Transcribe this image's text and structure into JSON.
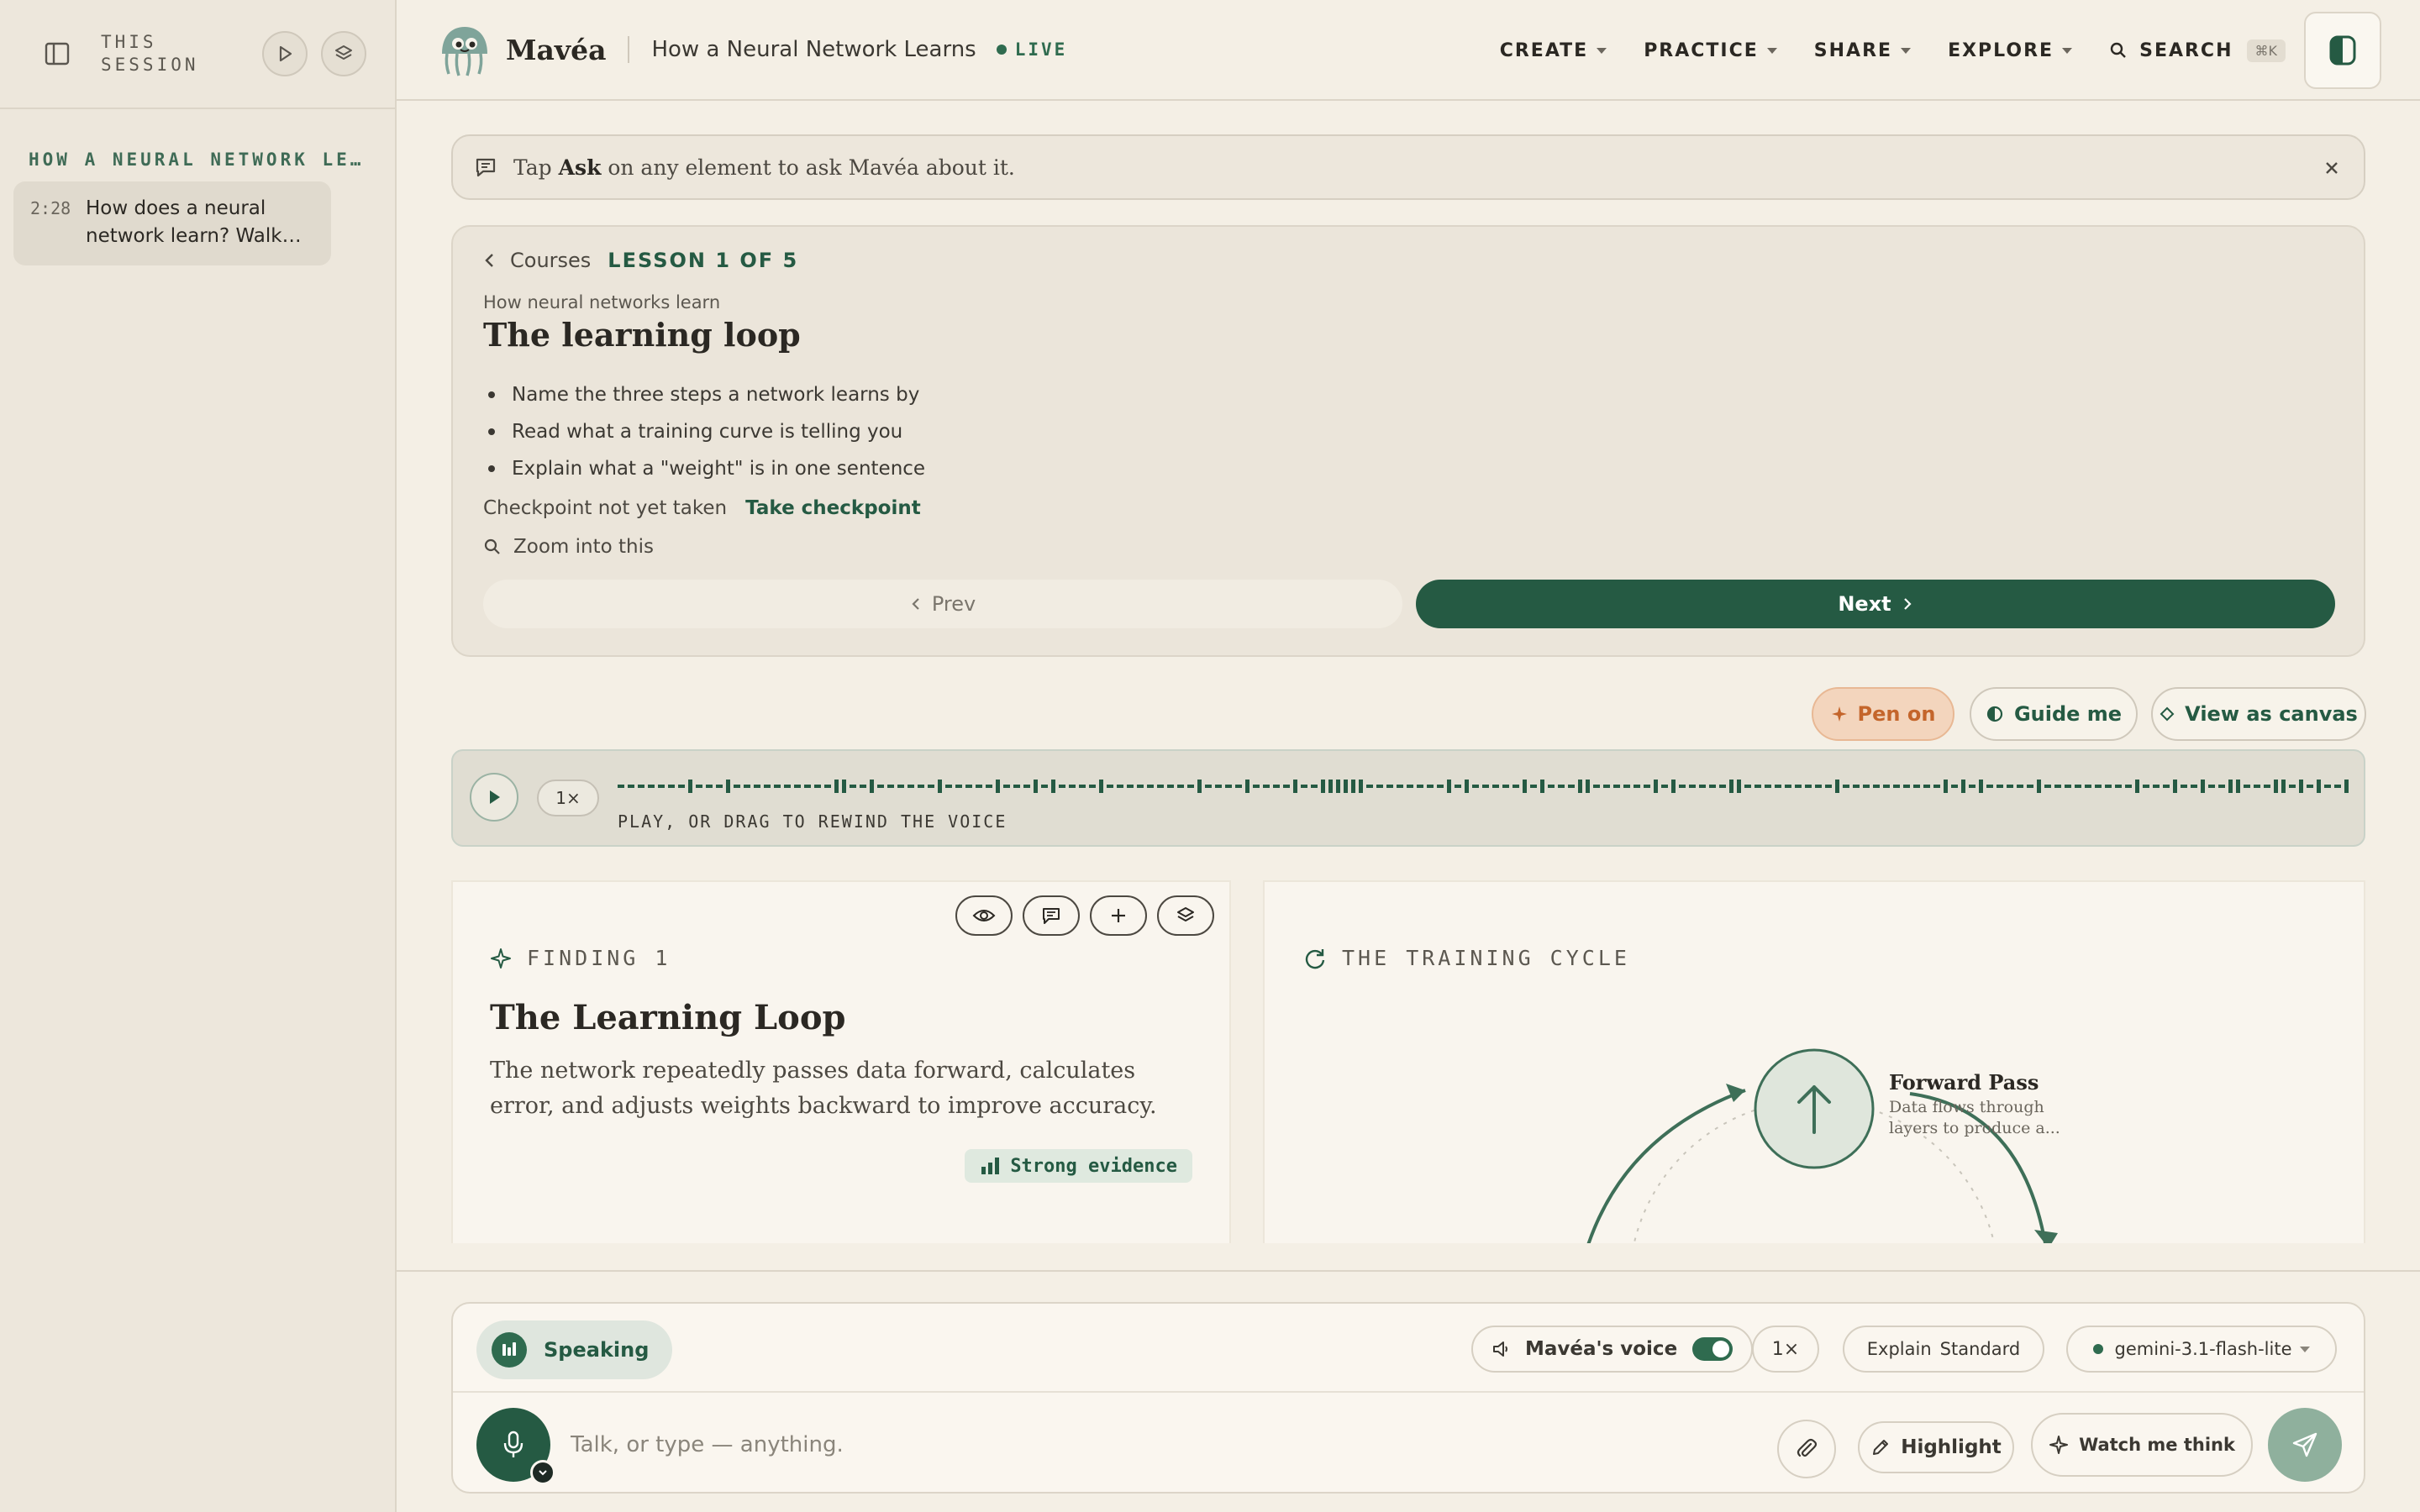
{
  "sidebar": {
    "session_label": "THIS\nSESSION",
    "section_title": "HOW A NEURAL NETWORK LE…",
    "items": [
      {
        "time": "2:28",
        "text": "How does a neural network learn? Walk…"
      }
    ]
  },
  "header": {
    "brand": "Mavéa",
    "lesson_title": "How a Neural Network Learns",
    "status": "LIVE",
    "nav": [
      "CREATE",
      "PRACTICE",
      "SHARE",
      "EXPLORE"
    ],
    "search_label": "SEARCH",
    "search_shortcut": "⌘K"
  },
  "tip": {
    "prefix": "Tap ",
    "keyword": "Ask",
    "suffix": " on any element to ask Mavéa about it."
  },
  "lesson": {
    "back_label": "Courses",
    "progress": "LESSON 1 OF 5",
    "course": "How neural networks learn",
    "title": "The learning loop",
    "objectives": [
      "Name the three steps a network learns by",
      "Read what a training curve is telling you",
      "Explain what a \"weight\" is in one sentence"
    ],
    "checkpoint_status": "Checkpoint not yet taken",
    "checkpoint_action": "Take checkpoint",
    "zoom_label": "Zoom into this",
    "prev_label": "Prev",
    "next_label": "Next"
  },
  "actions": {
    "pen": "Pen on",
    "guide": "Guide me",
    "canvas": "View as canvas"
  },
  "audio": {
    "speed": "1×",
    "hint": "PLAY, OR DRAG TO REWIND THE VOICE"
  },
  "finding": {
    "kicker": "FINDING 1",
    "title": "The Learning Loop",
    "body": "The network repeatedly passes data forward, calculates error, and adjusts weights backward to improve accuracy.",
    "evidence": "Strong evidence"
  },
  "cycle": {
    "kicker": "THE TRAINING CYCLE",
    "step_title": "Forward Pass",
    "step_desc": "Data flows through layers to produce a..."
  },
  "composer": {
    "speaking": "Speaking",
    "voice_label": "Mavéa's voice",
    "rate": "1×",
    "explain_label": "Explain",
    "explain_value": "Standard",
    "model": "gemini-3.1-flash-lite",
    "placeholder": "Talk, or type — anything.",
    "highlight": "Highlight",
    "think": "Watch me think"
  },
  "colors": {
    "accent": "#255a43",
    "background": "#f4efe5",
    "pen": "#c4652b"
  }
}
